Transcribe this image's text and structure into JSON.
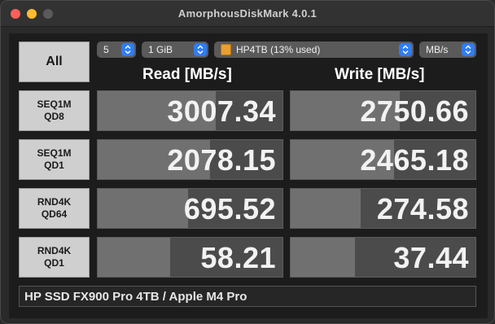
{
  "window": {
    "title": "AmorphousDiskMark 4.0.1"
  },
  "controls": {
    "all_label": "All",
    "count": "5",
    "size": "1 GiB",
    "drive": "HP4TB (13% used)",
    "unit": "MB/s"
  },
  "headers": {
    "read": "Read [MB/s]",
    "write": "Write [MB/s]"
  },
  "rows": [
    {
      "line1": "SEQ1M",
      "line2": "QD8",
      "read": "3007.34",
      "write": "2750.66",
      "read_fill": 0.64,
      "write_fill": 0.59
    },
    {
      "line1": "SEQ1M",
      "line2": "QD1",
      "read": "2078.15",
      "write": "2465.18",
      "read_fill": 0.61,
      "write_fill": 0.56
    },
    {
      "line1": "RND4K",
      "line2": "QD64",
      "read": "695.52",
      "write": "274.58",
      "read_fill": 0.49,
      "write_fill": 0.38
    },
    {
      "line1": "RND4K",
      "line2": "QD1",
      "read": "58.21",
      "write": "37.44",
      "read_fill": 0.39,
      "write_fill": 0.35
    }
  ],
  "comment": "HP SSD FX900 Pro 4TB / Apple M4 Pro",
  "colors": {
    "close": "#ff5f57",
    "minimize": "#febc2e",
    "accent": "#2f7cf6",
    "drive_icon": "#e8a030"
  }
}
